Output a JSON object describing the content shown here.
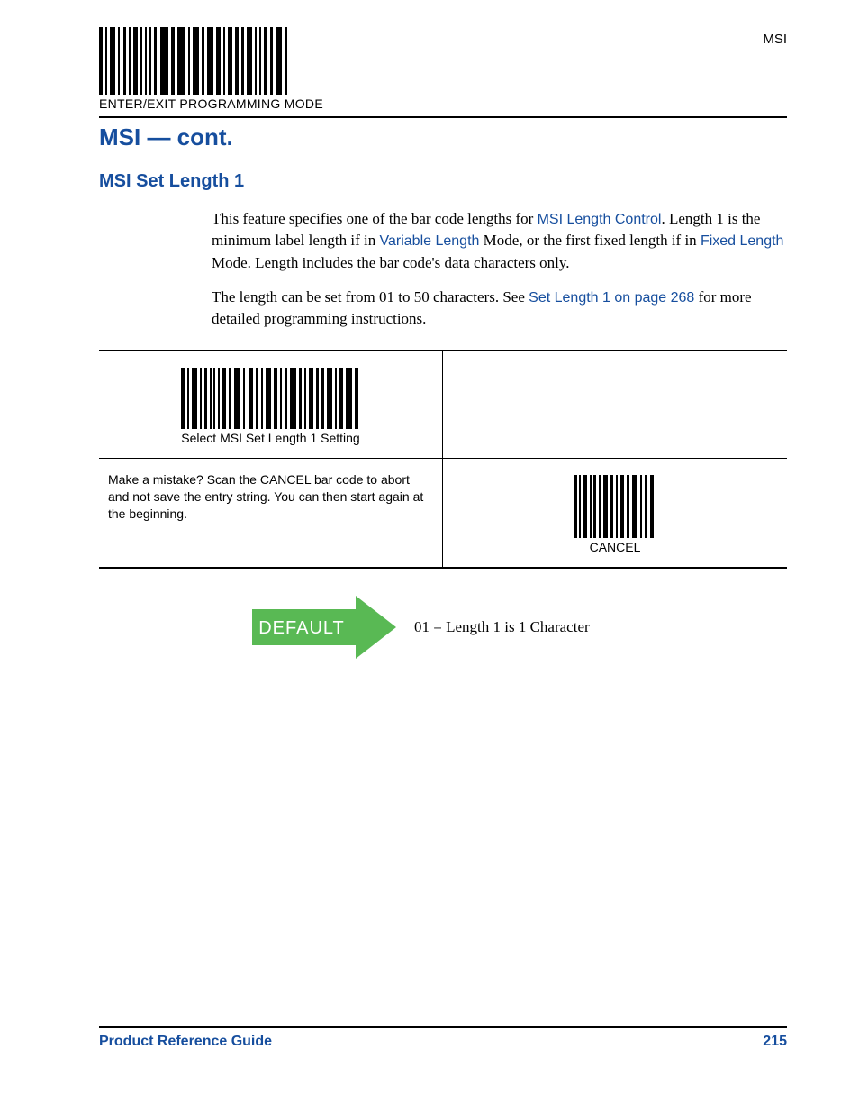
{
  "header": {
    "right_label": "MSI",
    "top_barcode_label": "ENTER/EXIT PROGRAMMING MODE"
  },
  "titles": {
    "section": "MSI — cont.",
    "subsection": "MSI Set Length 1"
  },
  "body": {
    "p1_a": "This feature specifies one of the bar code lengths for ",
    "p1_link1": "MSI Length Control",
    "p1_b": ". Length 1 is the minimum label length if in ",
    "p1_link2": "Variable Length",
    "p1_c": " Mode, or the first fixed length if in ",
    "p1_link3": "Fixed Length",
    "p1_d": " Mode. Length includes the bar code's data characters only.",
    "p2_a": "The length can be set from 01 to 50 characters. See ",
    "p2_link1": "Set Length 1 on page 268",
    "p2_b": " for more detailed programming instructions."
  },
  "table": {
    "row1": {
      "left_label": "Select MSI Set Length 1 Setting"
    },
    "row2": {
      "left_text": "Make a mistake? Scan the CANCEL bar code to abort and not save the entry string. You can then start again at the beginning.",
      "right_label": "CANCEL"
    }
  },
  "default": {
    "arrow_label": "DEFAULT",
    "text": "01 = Length 1 is 1 Character"
  },
  "footer": {
    "guide": "Product Reference Guide",
    "page": "215"
  }
}
